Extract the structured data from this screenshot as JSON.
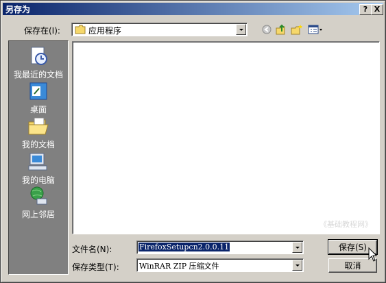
{
  "window": {
    "title": "另存为",
    "help_glyph": "?",
    "close_glyph": "X"
  },
  "savein": {
    "label": "保存在(I):",
    "value": "应用程序"
  },
  "places": [
    {
      "label": "我最近的文档"
    },
    {
      "label": "桌面"
    },
    {
      "label": "我的文档"
    },
    {
      "label": "我的电脑"
    },
    {
      "label": "网上邻居"
    }
  ],
  "filelist": {
    "watermark": "《基础教程网》"
  },
  "filename": {
    "label": "文件名(N):",
    "value": "FirefoxSetupcn2.0.0.11"
  },
  "filetype": {
    "label": "保存类型(T):",
    "value": "WinRAR ZIP 压缩文件"
  },
  "buttons": {
    "save": "保存(S)",
    "cancel": "取消"
  },
  "icons": [
    "back-icon",
    "up-folder-icon",
    "new-folder-icon",
    "view-menu-icon"
  ]
}
